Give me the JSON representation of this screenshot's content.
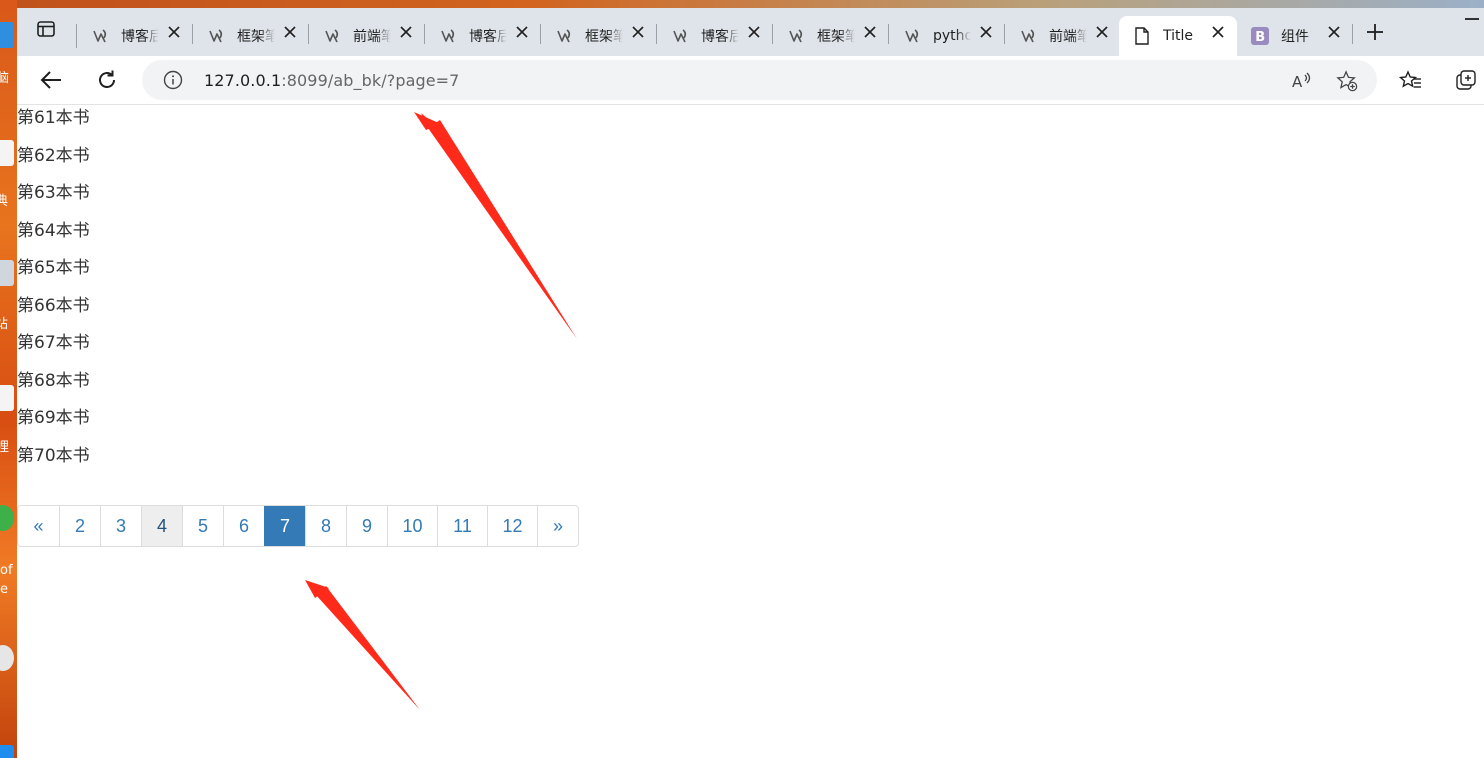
{
  "desktop": {
    "labels": [
      "脑",
      "典",
      "站",
      "哩",
      "of",
      "e"
    ]
  },
  "browser": {
    "tabs": [
      {
        "label": "博客后",
        "favicon": "django-icon"
      },
      {
        "label": "框架笔",
        "favicon": "django-icon"
      },
      {
        "label": "前端笔",
        "favicon": "django-icon"
      },
      {
        "label": "博客后",
        "favicon": "django-icon"
      },
      {
        "label": "框架笔",
        "favicon": "django-icon"
      },
      {
        "label": "博客后",
        "favicon": "django-icon"
      },
      {
        "label": "框架笔",
        "favicon": "django-icon"
      },
      {
        "label": "python",
        "favicon": "django-icon"
      },
      {
        "label": "前端笔",
        "favicon": "django-icon"
      },
      {
        "label": "Title",
        "favicon": "page-icon",
        "active": true
      },
      {
        "label": "组件",
        "favicon": "bootstrap-icon"
      }
    ],
    "address": {
      "host": "127.0.0.1",
      "rest": ":8099/ab_bk/?page=7"
    }
  },
  "page": {
    "books": [
      "第61本书",
      "第62本书",
      "第63本书",
      "第64本书",
      "第65本书",
      "第66本书",
      "第67本书",
      "第68本书",
      "第69本书",
      "第70本书"
    ],
    "pagination": {
      "prev": "«",
      "next": "»",
      "pages": [
        "2",
        "3",
        "4",
        "5",
        "6",
        "7",
        "8",
        "9",
        "10",
        "11",
        "12"
      ],
      "active_page": "7",
      "hover_page": "4"
    }
  },
  "colors": {
    "link": "#337ab7",
    "active_bg": "#337ab7",
    "annotation_arrow": "#ff2a1a"
  }
}
